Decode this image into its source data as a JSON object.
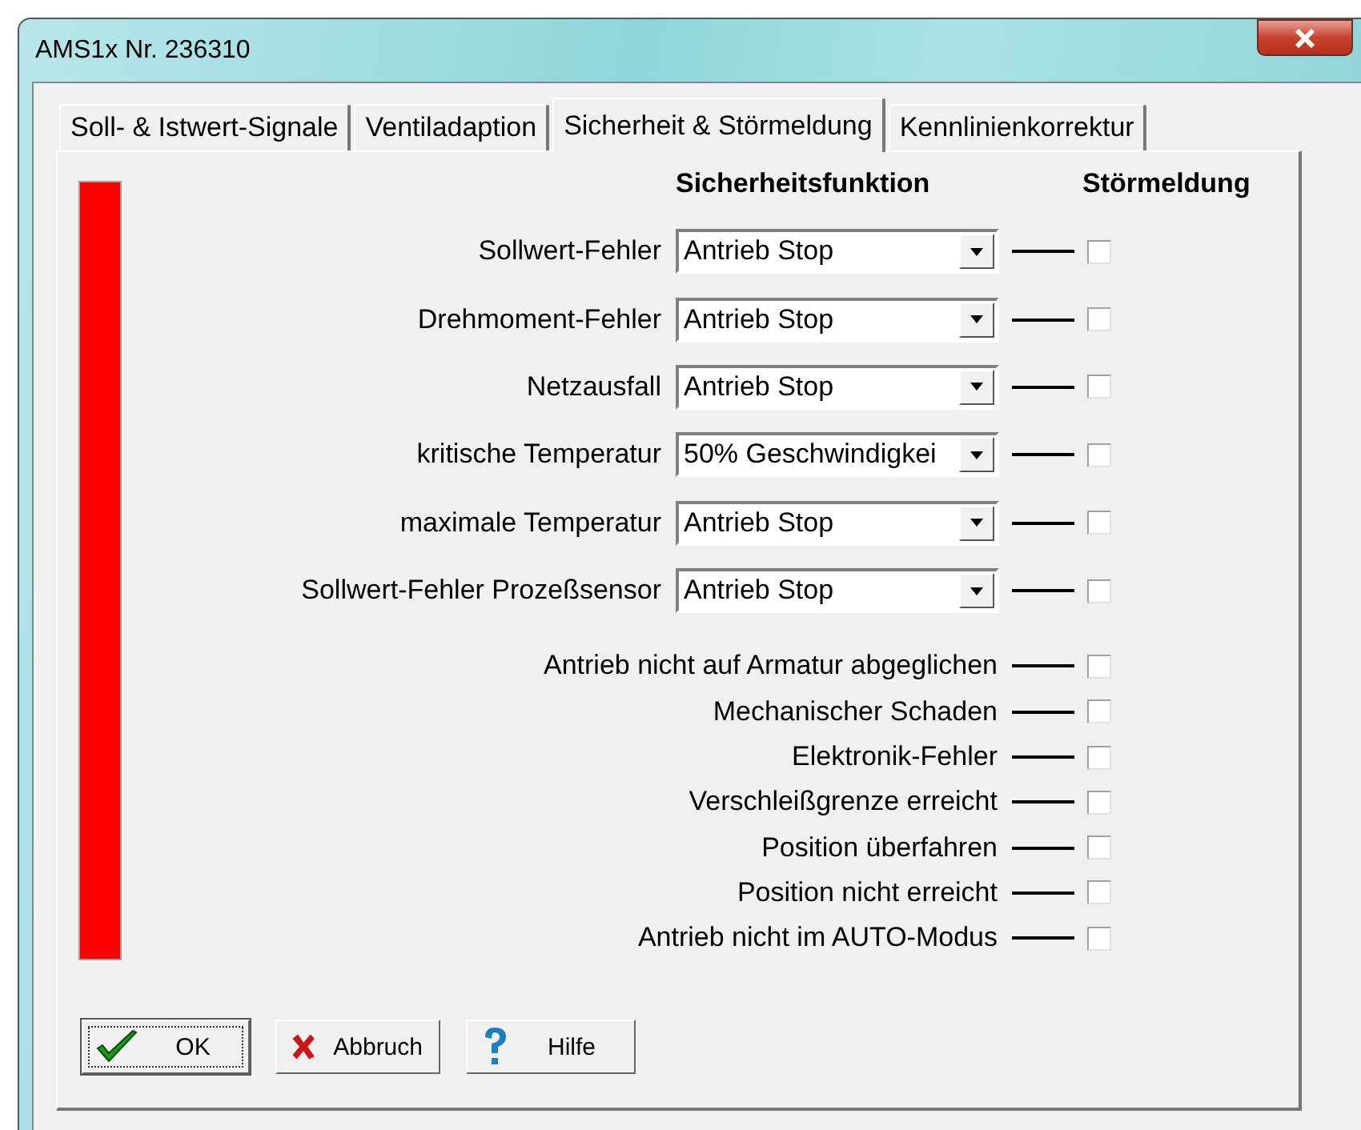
{
  "window": {
    "title": "AMS1x Nr. 236310"
  },
  "tabs": [
    {
      "label": "Soll- & Istwert-Signale",
      "selected": false
    },
    {
      "label": "Ventiladaption",
      "selected": false
    },
    {
      "label": "Sicherheit & Störmeldung",
      "selected": true
    },
    {
      "label": "Kennlinienkorrektur",
      "selected": false
    }
  ],
  "headers": {
    "function": "Sicherheitsfunktion",
    "message": "Störmeldung"
  },
  "safety_rows": [
    {
      "label": "Sollwert-Fehler",
      "value": "Antrieb Stop",
      "checked": false
    },
    {
      "label": "Drehmoment-Fehler",
      "value": "Antrieb Stop",
      "checked": false
    },
    {
      "label": "Netzausfall",
      "value": "Antrieb Stop",
      "checked": false
    },
    {
      "label": "kritische Temperatur",
      "value": "50% Geschwindigkei",
      "checked": false
    },
    {
      "label": "maximale Temperatur",
      "value": "Antrieb Stop",
      "checked": false
    },
    {
      "label": "Sollwert-Fehler Prozeßsensor",
      "value": "Antrieb Stop",
      "checked": false
    }
  ],
  "message_rows": [
    {
      "label": "Antrieb nicht auf Armatur abgeglichen",
      "checked": false
    },
    {
      "label": "Mechanischer Schaden",
      "checked": false
    },
    {
      "label": "Elektronik-Fehler",
      "checked": false
    },
    {
      "label": "Verschleißgrenze erreicht",
      "checked": false
    },
    {
      "label": "Position überfahren",
      "checked": false
    },
    {
      "label": "Position nicht erreicht",
      "checked": false
    },
    {
      "label": "Antrieb nicht im AUTO-Modus",
      "checked": false
    }
  ],
  "buttons": [
    {
      "label": "OK",
      "kind": "ok",
      "focused": true
    },
    {
      "label": "Abbruch",
      "kind": "cancel",
      "focused": false
    },
    {
      "label": "Hilfe",
      "kind": "help",
      "focused": false
    }
  ]
}
